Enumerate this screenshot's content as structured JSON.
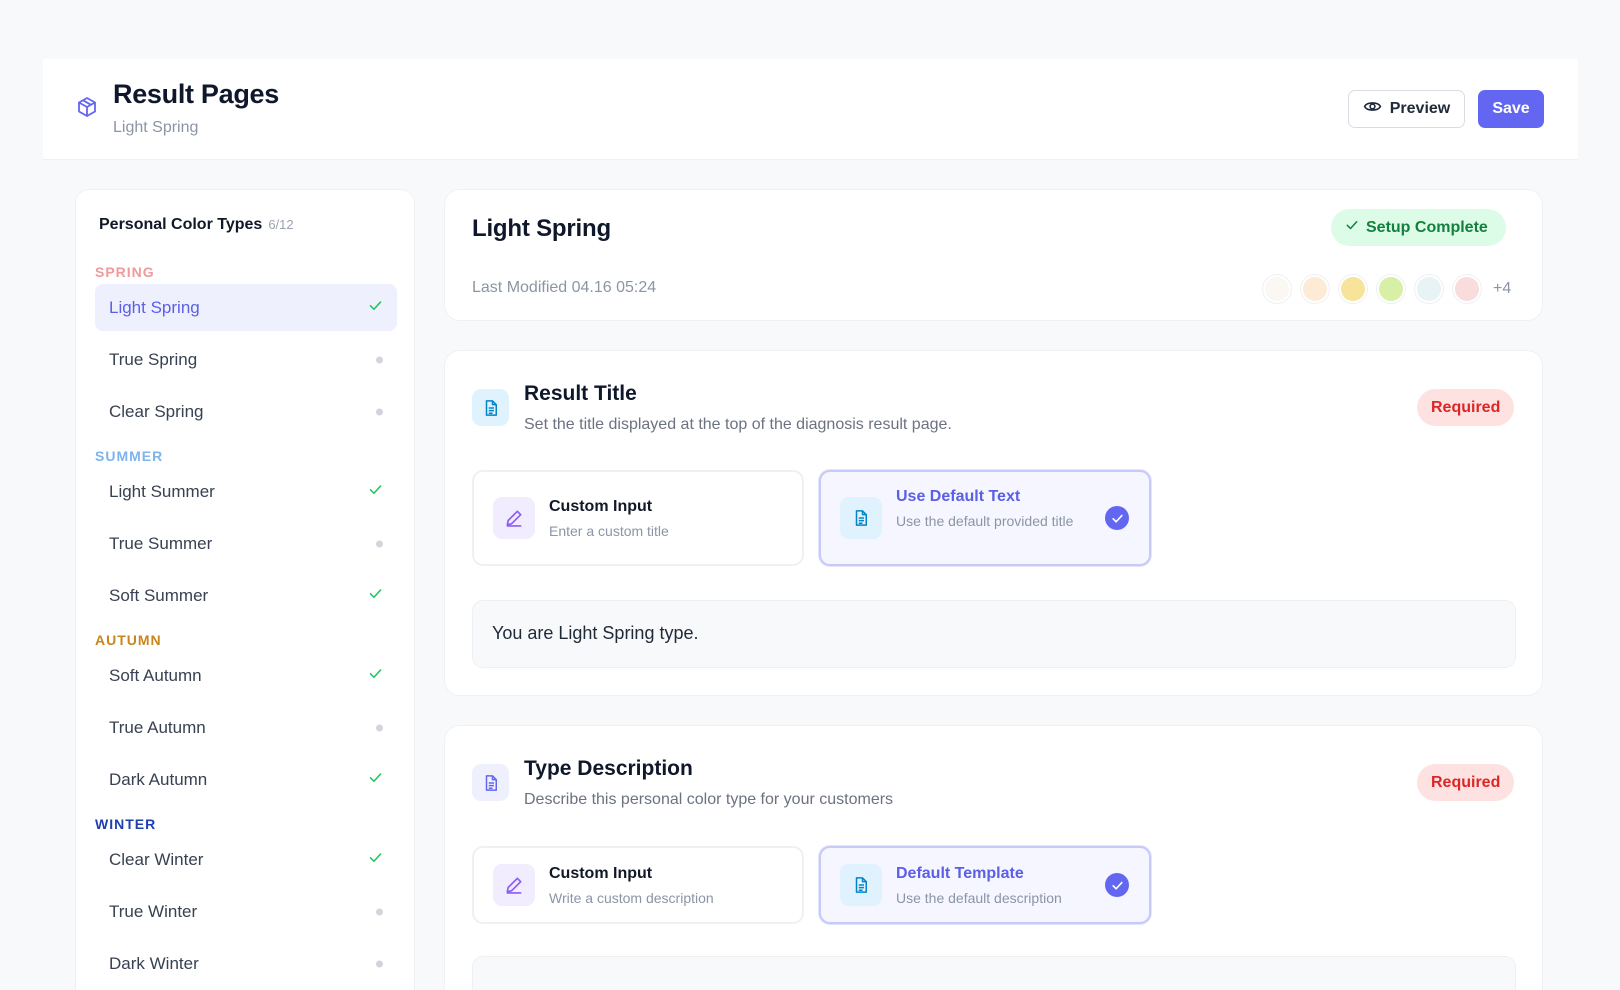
{
  "header": {
    "title": "Result Pages",
    "subtitle": "Light Spring",
    "logo_icon": "cube-icon",
    "preview_label": "Preview",
    "save_label": "Save",
    "accent_color": "#6366f1"
  },
  "sidebar": {
    "title": "Personal Color Types",
    "count": "6/12",
    "groups": [
      {
        "label": "SPRING",
        "color": "#f09a9a"
      },
      {
        "label": "SUMMER",
        "color": "#7fb3ee"
      },
      {
        "label": "AUTUMN",
        "color": "#c9861c"
      },
      {
        "label": "WINTER",
        "color": "#1e40af"
      }
    ],
    "items": [
      {
        "label": "Light Spring",
        "status": "done",
        "active": true
      },
      {
        "label": "True Spring",
        "status": "pending"
      },
      {
        "label": "Clear Spring",
        "status": "pending"
      },
      {
        "label": "Light Summer",
        "status": "done"
      },
      {
        "label": "True Summer",
        "status": "pending"
      },
      {
        "label": "Soft Summer",
        "status": "done"
      },
      {
        "label": "Soft Autumn",
        "status": "done"
      },
      {
        "label": "True Autumn",
        "status": "pending"
      },
      {
        "label": "Dark Autumn",
        "status": "done"
      },
      {
        "label": "Clear Winter",
        "status": "done"
      },
      {
        "label": "True Winter",
        "status": "pending"
      },
      {
        "label": "Dark Winter",
        "status": "pending"
      }
    ]
  },
  "overview": {
    "title": "Light Spring",
    "status_badge": "Setup Complete",
    "last_modified": "Last Modified 04.16 05:24",
    "swatches": [
      "#fbf8f3",
      "#fdebd6",
      "#f7e39a",
      "#d8f0a6",
      "#e7f3f4",
      "#f9dcdc"
    ],
    "more_count": "+4"
  },
  "result_title": {
    "title": "Result Title",
    "description": "Set the title displayed at the top of the diagnosis result page.",
    "badge": "Required",
    "options": [
      {
        "title": "Custom Input",
        "desc": "Enter a custom title",
        "icon": "pencil-icon",
        "selected": false
      },
      {
        "title": "Use Default Text",
        "desc": "Use the default provided title",
        "icon": "document-icon",
        "selected": true
      }
    ],
    "value": "You are Light Spring type."
  },
  "type_description": {
    "title": "Type Description",
    "description": "Describe this personal color type for your customers",
    "badge": "Required",
    "options": [
      {
        "title": "Custom Input",
        "desc": "Write a custom description",
        "icon": "pencil-icon",
        "selected": false
      },
      {
        "title": "Default Template",
        "desc": "Use the default description",
        "icon": "document-icon",
        "selected": true
      }
    ]
  }
}
